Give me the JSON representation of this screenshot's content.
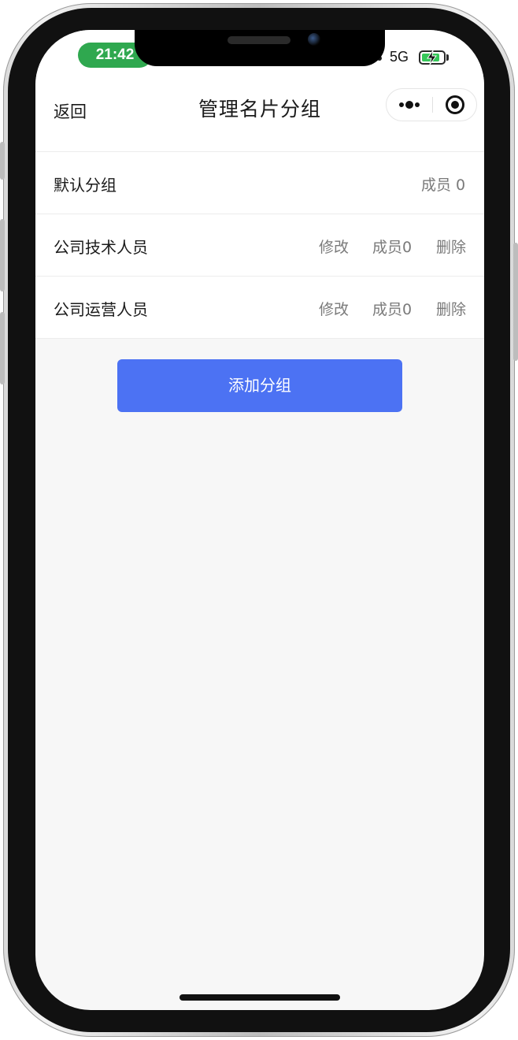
{
  "status_bar": {
    "time": "21:42",
    "network": "5G",
    "battery_level": 0.85,
    "battery_color": "#35c759",
    "time_pill_color": "#2fa84f"
  },
  "nav": {
    "back_label": "返回",
    "title": "管理名片分组",
    "more_icon": "more-dots-icon",
    "close_icon": "miniprogram-close-icon"
  },
  "groups": [
    {
      "name": "默认分组",
      "members_label": "成员 0"
    },
    {
      "name": "公司技术人员",
      "edit_label": "修改",
      "members_label": "成员0",
      "delete_label": "删除"
    },
    {
      "name": "公司运营人员",
      "edit_label": "修改",
      "members_label": "成员0",
      "delete_label": "删除"
    }
  ],
  "add_group_label": "添加分组",
  "colors": {
    "primary": "#4c72f3",
    "page_background": "#f7f7f7",
    "secondary_text": "#7a7a7a"
  }
}
